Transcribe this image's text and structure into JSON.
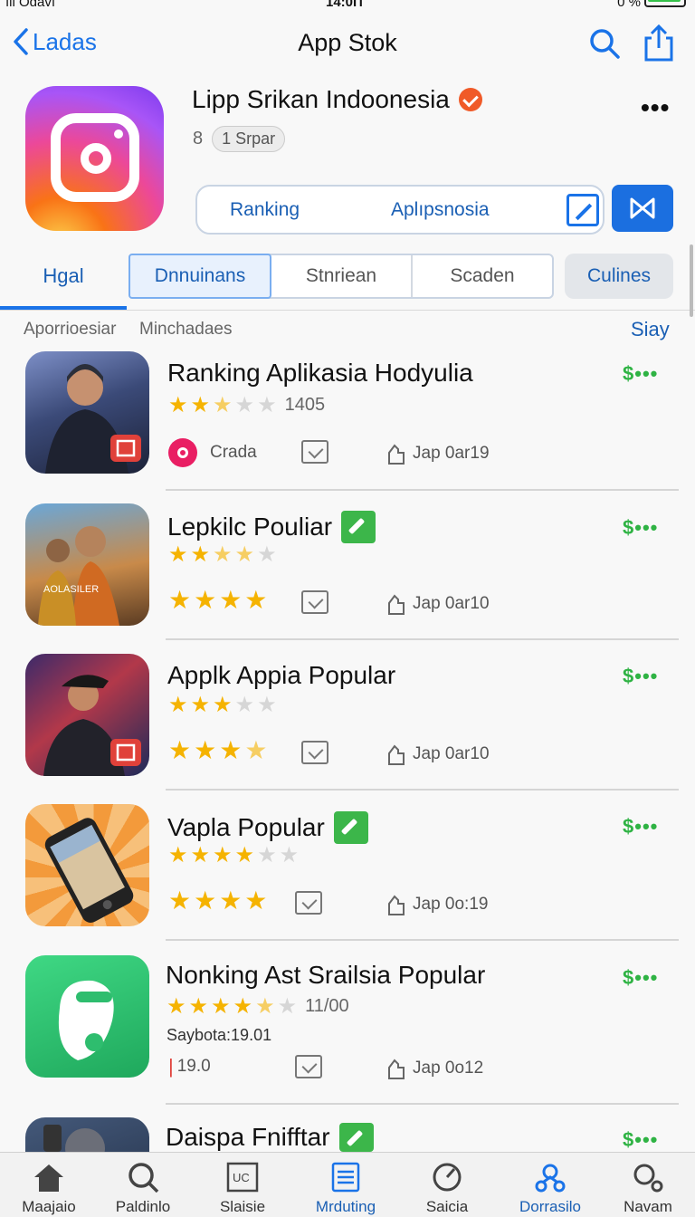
{
  "status": {
    "carrier": "ıll Odavı",
    "time": "14:0Π",
    "battery_text": "0 %"
  },
  "nav": {
    "back_label": "Ladas",
    "title": "App Stok"
  },
  "app": {
    "name": "Lipp Srikan Indoonesia",
    "meta_number": "8",
    "meta_pill": "1 Srpar",
    "segment_a": "Ranking",
    "segment_b": "Aplıpsnosia"
  },
  "tabs": {
    "first": "Hgal",
    "segments": [
      "Dnnuinans",
      "Stnriean",
      "Scaden"
    ],
    "last": "Culines"
  },
  "subheader": {
    "left": "Aporrioesiar",
    "middle": "Minchadaes",
    "right": "Siay"
  },
  "rows": [
    {
      "title": "Ranking Aplikasia Hodyulia",
      "stars": "★★",
      "stars_half": "★",
      "stars_off": "★★",
      "count": "1405",
      "chip": "Crada",
      "date": "Jap 0ar19",
      "price": "$•••"
    },
    {
      "title": "Lepkilc Pouliar",
      "stars": "★★",
      "stars_half": "★★",
      "stars_off": "★",
      "stars2": "★★★★",
      "date": "Jap 0ar10",
      "price": "$•••"
    },
    {
      "title": "Applk Appia Popular",
      "stars": "★★★",
      "stars_off": "★★",
      "stars2": "★★★",
      "stars2_half": "★",
      "date": "Jap 0ar10",
      "price": "$•••"
    },
    {
      "title": "Vapla Popular",
      "stars": "★★★★",
      "stars_off": "★★",
      "stars2": "★★★★",
      "date": "Jap 0o:19",
      "price": "$•••"
    },
    {
      "title": "Nonking Ast Srailsia Popular",
      "stars": "★★★★",
      "stars_half": "★",
      "stars_off": "★",
      "count": "11/00",
      "extra": "Saybota:19.01",
      "chip": "19.0",
      "date": "Jap 0o12",
      "price": "$•••"
    },
    {
      "title": "Daispa Fnifftar",
      "price": "$•••"
    }
  ],
  "tabbar": [
    "Maajaio",
    "Paldinlo",
    "Slaisie",
    "Mrduting",
    "Saicia",
    "Dorrasilo",
    "Navam"
  ],
  "colors": {
    "accent": "#1a73e8",
    "price": "#2fb344",
    "star": "#f5b301"
  }
}
